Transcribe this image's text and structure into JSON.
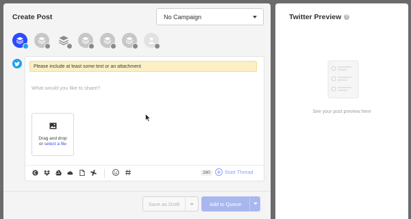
{
  "create_post": {
    "title": "Create Post",
    "campaign_select": {
      "value": "No Campaign"
    },
    "profiles": [
      {
        "id": "profile-1",
        "icon": "buffer-layers",
        "badge": "twitter",
        "selected": true
      },
      {
        "id": "profile-2",
        "icon": "buffer-layers",
        "badge": "instagram",
        "selected": false
      },
      {
        "id": "profile-3",
        "icon": "buffer-layers",
        "badge": "pinterest",
        "selected": false
      },
      {
        "id": "profile-4",
        "icon": "buffer-layers",
        "badge": "linkedin",
        "selected": false
      },
      {
        "id": "profile-5",
        "icon": "buffer-layers",
        "badge": "twitter",
        "selected": false
      },
      {
        "id": "profile-6",
        "icon": "buffer-layers",
        "badge": "facebook",
        "selected": false
      },
      {
        "id": "profile-7",
        "icon": "user",
        "badge": "linkedin",
        "selected": false
      }
    ],
    "network_icon": "twitter-icon",
    "warning": "Please include at least some text or an attachment",
    "placeholder": "What would you like to share?",
    "upload": {
      "line1": "Drag and drop",
      "line2_prefix": "or ",
      "line2_link": "select a file"
    },
    "toolbar": {
      "icons": [
        "canva-icon",
        "dropbox-icon",
        "google-drive-icon",
        "onedrive-icon",
        "document-icon",
        "slack-icon",
        "emoji-icon",
        "hashtag-icon"
      ],
      "char_count": "280",
      "start_thread": "Start Thread"
    },
    "footer": {
      "save_draft": "Save as Draft",
      "add_to_queue": "Add to Queue"
    }
  },
  "twitter_preview": {
    "title": "Twitter Preview",
    "help": "?",
    "caption": "See your post preview here"
  },
  "colors": {
    "accent": "#2c4bff",
    "twitter": "#1da1f2",
    "warning_bg": "#fbf0c4",
    "queue_button": "#a9b7ef"
  }
}
